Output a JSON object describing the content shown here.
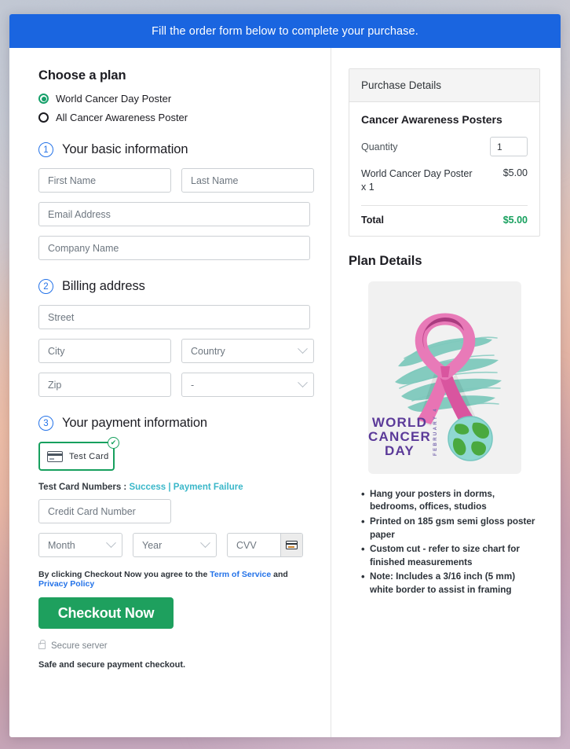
{
  "banner": {
    "text": "Fill the order form below to complete your purchase."
  },
  "plan": {
    "heading": "Choose a plan",
    "options": [
      {
        "label": "World Cancer Day Poster",
        "selected": true
      },
      {
        "label": "All Cancer Awareness Poster",
        "selected": false
      }
    ]
  },
  "steps": {
    "basic": {
      "number": "1",
      "title": "Your basic information"
    },
    "billing": {
      "number": "2",
      "title": "Billing address"
    },
    "payment": {
      "number": "3",
      "title": "Your payment information"
    }
  },
  "fields": {
    "first_name": "First Name",
    "last_name": "Last Name",
    "email": "Email Address",
    "company": "Company Name",
    "street": "Street",
    "city": "City",
    "country": "Country",
    "zip": "Zip",
    "state": "-",
    "credit_card": "Credit Card Number",
    "month": "Month",
    "year": "Year",
    "cvv": "CVV"
  },
  "payment": {
    "test_card_label": "Test  Card",
    "check_glyph": "✔",
    "test_numbers_prefix": "Test Card Numbers : ",
    "success_link": "Success",
    "separator": " | ",
    "failure_link": "Payment Failure"
  },
  "terms": {
    "prefix": "By clicking Checkout Now you agree to the ",
    "tos": "Term of Service",
    "middle": " and ",
    "privacy": "Privacy Policy"
  },
  "checkout": {
    "button": "Checkout Now",
    "secure_server": "Secure server",
    "safe_note": "Safe and secure payment checkout."
  },
  "purchase": {
    "panel_title": "Purchase Details",
    "product_title": "Cancer Awareness Posters",
    "quantity_label": "Quantity",
    "quantity_value": "1",
    "line_item_name": "World Cancer Day Poster x 1",
    "line_item_price": "$5.00",
    "total_label": "Total",
    "total_value": "$5.00"
  },
  "plan_details": {
    "heading": "Plan Details",
    "poster": {
      "line1": "WORLD",
      "line2": "CANCER",
      "line3": "DAY",
      "vertical": "FEBRUARY 4"
    },
    "bullets": [
      "Hang your posters in dorms, bedrooms, offices, studios",
      "Printed on 185 gsm semi gloss poster paper",
      "Custom cut - refer to size chart for finished measurements",
      "Note: Includes a 3/16 inch (5 mm) white border to assist in framing"
    ]
  },
  "colors": {
    "banner_blue": "#1a65e0",
    "accent_green": "#17a05e",
    "link_blue": "#2372e8",
    "link_teal": "#3ab7c9",
    "step_blue": "#2372e8"
  }
}
